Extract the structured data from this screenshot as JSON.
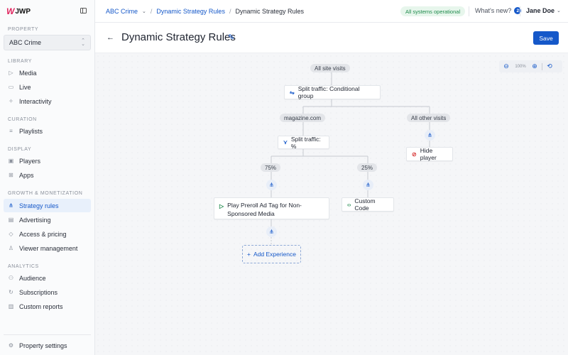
{
  "brand": {
    "mark": "W",
    "name": "JWP"
  },
  "sidebar": {
    "property_label": "PROPERTY",
    "property_value": "ABC Crime",
    "sections": [
      {
        "label": "LIBRARY"
      },
      {
        "label": "CURATION"
      },
      {
        "label": "DISPLAY"
      },
      {
        "label": "GROWTH & MONETIZATION"
      },
      {
        "label": "ANALYTICS"
      }
    ],
    "items": [
      {
        "label": "Media",
        "icon": "play-icon"
      },
      {
        "label": "Live",
        "icon": "live-camera-icon"
      },
      {
        "label": "Interactivity",
        "icon": "sparkle-icon"
      },
      {
        "label": "Playlists",
        "icon": "playlist-icon"
      },
      {
        "label": "Players",
        "icon": "player-icon"
      },
      {
        "label": "Apps",
        "icon": "apps-grid-icon"
      },
      {
        "label": "Strategy rules",
        "icon": "strategy-icon",
        "active": true
      },
      {
        "label": "Advertising",
        "icon": "advertising-icon"
      },
      {
        "label": "Access & pricing",
        "icon": "tag-icon"
      },
      {
        "label": "Viewer management",
        "icon": "user-icon"
      },
      {
        "label": "Audience",
        "icon": "audience-icon"
      },
      {
        "label": "Subscriptions",
        "icon": "refresh-icon"
      },
      {
        "label": "Custom reports",
        "icon": "report-icon"
      }
    ],
    "footer_item": {
      "label": "Property settings",
      "icon": "gear-icon"
    }
  },
  "header": {
    "breadcrumb": [
      "ABC Crime",
      "Dynamic Strategy Rules",
      "Dynamic Strategy Rules"
    ],
    "breadcrumb_sep": "/",
    "status": "All systems operational",
    "whats_new": "What's new?",
    "whats_new_count": "2",
    "user_name": "Jane Doe"
  },
  "page": {
    "title": "Dynamic Strategy Rules",
    "save_label": "Save"
  },
  "canvas": {
    "zoom_level": "100%",
    "root_label": "All site visits",
    "nodes": {
      "conditional_group": "Split traffic: Conditional group",
      "branch_magazine": "magazine.com",
      "branch_other": "All other visits",
      "split_percent": "Split traffic: %",
      "hide_player": "Hide player",
      "pct_75": "75%",
      "pct_25": "25%",
      "preroll": "Play Preroll Ad Tag for Non-Sponsored Media",
      "custom_code": "Custom Code",
      "add_experience": "Add Experience"
    }
  },
  "colors": {
    "accent": "#1558c9",
    "status_green": "#1f8a4c",
    "brand_pink": "#e0245e",
    "hide_red": "#d93a3a",
    "custom_green": "#1f8a4c"
  }
}
